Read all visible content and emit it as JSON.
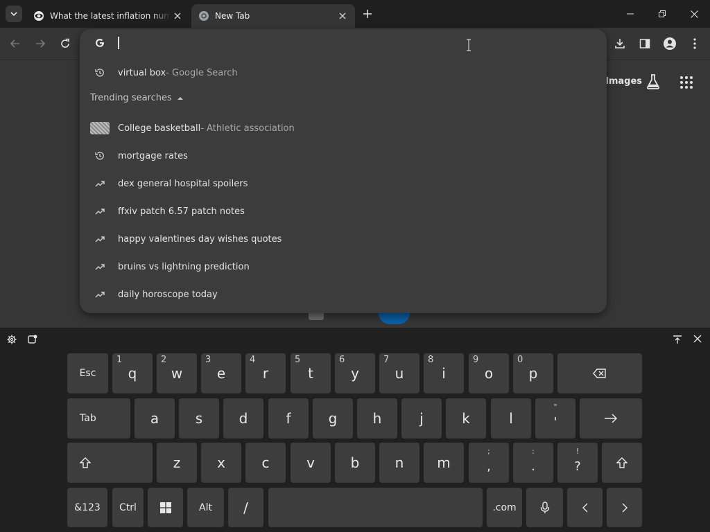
{
  "browser": {
    "tabs": [
      {
        "title": "What the latest inflation numbers"
      },
      {
        "title": "New Tab"
      }
    ]
  },
  "page": {
    "images_link": "Images"
  },
  "omnibox": {
    "query": "",
    "suggestions_top": [
      {
        "text": "virtual box",
        "sub": " - Google Search",
        "icon": "history-icon"
      }
    ],
    "trending_header": "Trending searches",
    "trending": [
      {
        "text": "College basketball",
        "sub": " - Athletic association",
        "icon": "thumbnail-image"
      },
      {
        "text": "mortgage rates",
        "sub": "",
        "icon": "history-icon"
      },
      {
        "text": "dex general hospital spoilers",
        "sub": "",
        "icon": "trending-icon"
      },
      {
        "text": "ffxiv patch 6.57 patch notes",
        "sub": "",
        "icon": "trending-icon"
      },
      {
        "text": "happy valentines day wishes quotes",
        "sub": "",
        "icon": "trending-icon"
      },
      {
        "text": "bruins vs lightning prediction",
        "sub": "",
        "icon": "trending-icon"
      },
      {
        "text": "daily horoscope today",
        "sub": "",
        "icon": "trending-icon"
      }
    ]
  },
  "keyboard": {
    "row1": [
      {
        "label": "Esc"
      },
      {
        "label": "q",
        "num": "1"
      },
      {
        "label": "w",
        "num": "2"
      },
      {
        "label": "e",
        "num": "3"
      },
      {
        "label": "r",
        "num": "4"
      },
      {
        "label": "t",
        "num": "5"
      },
      {
        "label": "y",
        "num": "6"
      },
      {
        "label": "u",
        "num": "7"
      },
      {
        "label": "i",
        "num": "8"
      },
      {
        "label": "o",
        "num": "9"
      },
      {
        "label": "p",
        "num": "0"
      }
    ],
    "row2": [
      {
        "label": "Tab"
      },
      {
        "label": "a"
      },
      {
        "label": "s"
      },
      {
        "label": "d"
      },
      {
        "label": "f"
      },
      {
        "label": "g"
      },
      {
        "label": "h"
      },
      {
        "label": "j"
      },
      {
        "label": "k"
      },
      {
        "label": "l"
      },
      {
        "label": "'",
        "top": "\""
      }
    ],
    "row3": [
      {
        "label": "z"
      },
      {
        "label": "x"
      },
      {
        "label": "c"
      },
      {
        "label": "v"
      },
      {
        "label": "b"
      },
      {
        "label": "n"
      },
      {
        "label": "m"
      },
      {
        "label": ",",
        "top": ";"
      },
      {
        "label": ".",
        "top": ":"
      },
      {
        "label": "?",
        "top": "!"
      }
    ],
    "row4": [
      {
        "label": "&123"
      },
      {
        "label": "Ctrl"
      },
      {
        "label": "Alt"
      },
      {
        "label": "/"
      },
      {
        "label": ".com"
      }
    ]
  },
  "colors": {
    "titlebar": "#1f1f1f",
    "toolbar": "#353535",
    "omnibox": "#3c3c3c",
    "keyboard_bg": "#202020",
    "key": "#3d3d3d"
  }
}
